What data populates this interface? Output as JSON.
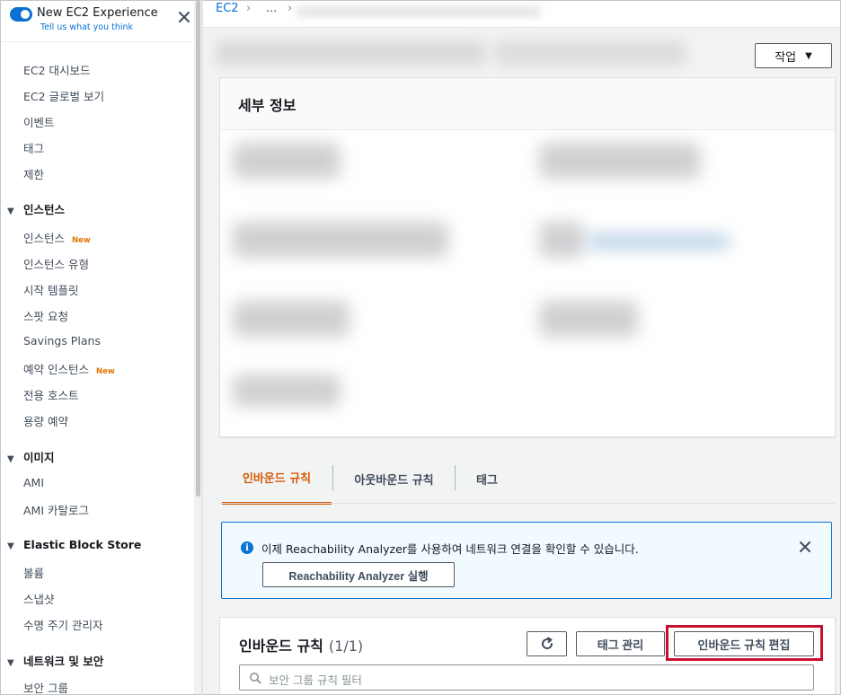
{
  "sidebar": {
    "new_experience": {
      "title": "New EC2 Experience",
      "subtitle": "Tell us what you think",
      "toggle_on": true
    },
    "top_items": [
      {
        "label": "EC2 대시보드"
      },
      {
        "label": "EC2 글로벌 보기"
      },
      {
        "label": "이벤트"
      },
      {
        "label": "태그"
      },
      {
        "label": "제한"
      }
    ],
    "sections": [
      {
        "title": "인스턴스",
        "items": [
          {
            "label": "인스턴스",
            "badge": "New"
          },
          {
            "label": "인스턴스 유형"
          },
          {
            "label": "시작 템플릿"
          },
          {
            "label": "스팟 요청"
          },
          {
            "label": "Savings Plans"
          },
          {
            "label": "예약 인스턴스",
            "badge": "New"
          },
          {
            "label": "전용 호스트"
          },
          {
            "label": "용량 예약"
          }
        ]
      },
      {
        "title": "이미지",
        "items": [
          {
            "label": "AMI"
          },
          {
            "label": "AMI 카탈로그"
          }
        ]
      },
      {
        "title": "Elastic Block Store",
        "items": [
          {
            "label": "볼륨"
          },
          {
            "label": "스냅샷"
          },
          {
            "label": "수명 주기 관리자"
          }
        ]
      },
      {
        "title": "네트워크 및 보안",
        "items": [
          {
            "label": "보안 그룹"
          }
        ]
      }
    ]
  },
  "breadcrumb": {
    "root": "EC2",
    "ellipsis": "..."
  },
  "header": {
    "actions_label": "작업"
  },
  "details": {
    "title": "세부 정보"
  },
  "tabs": [
    {
      "label": "인바운드 규칙",
      "active": true
    },
    {
      "label": "아웃바운드 규칙",
      "active": false
    },
    {
      "label": "태그",
      "active": false
    }
  ],
  "info_alert": {
    "message": "이제 Reachability Analyzer를 사용하여 네트워크 연결을 확인할 수 있습니다.",
    "button_label": "Reachability Analyzer 실행"
  },
  "inbound_rules": {
    "title": "인바운드 규칙",
    "count": "(1/1)",
    "tag_manage_label": "태그 관리",
    "edit_label": "인바운드 규칙 편집",
    "filter_placeholder": "보안 그룹 규칙 필터"
  },
  "colors": {
    "accent": "#0972d3",
    "active_tab": "#d45b07",
    "highlight_box": "#c8102e",
    "new_badge": "#e07700"
  }
}
